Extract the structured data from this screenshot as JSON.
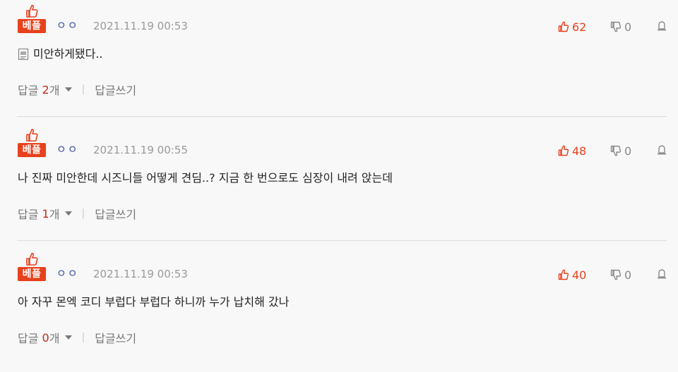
{
  "comments": [
    {
      "badge": "베플",
      "nickname": "ㅇㅇ",
      "timestamp": "2021.11.19 00:53",
      "likes": "62",
      "dislikes": "0",
      "body": "미안하게됐다..",
      "has_attachment_icon": true,
      "reply_label": "답글",
      "reply_count": "2",
      "reply_unit": "개",
      "write_reply": "답글쓰기"
    },
    {
      "badge": "베플",
      "nickname": "ㅇㅇ",
      "timestamp": "2021.11.19 00:55",
      "likes": "48",
      "dislikes": "0",
      "body": "나 진짜 미안한데 시즈니들 어떻게 견딤..? 지금 한 번으로도 심장이 내려 앉는데",
      "has_attachment_icon": false,
      "reply_label": "답글",
      "reply_count": "1",
      "reply_unit": "개",
      "write_reply": "답글쓰기"
    },
    {
      "badge": "베플",
      "nickname": "ㅇㅇ",
      "timestamp": "2021.11.19 00:53",
      "likes": "40",
      "dislikes": "0",
      "body": "아 자꾸 몬엑 코디 부럽다 부럽다 하니까 누가 납치해 갔나",
      "has_attachment_icon": false,
      "reply_label": "답글",
      "reply_count": "0",
      "reply_unit": "개",
      "write_reply": "답글쓰기"
    }
  ],
  "colors": {
    "accent": "#e8411d",
    "reply_count": "#c62b1a",
    "nickname": "#3a4aa0",
    "muted": "#999999",
    "background": "#f8f8f8"
  },
  "icons": {
    "best": "thumbs-up-icon",
    "like": "thumbs-up-icon",
    "dislike": "thumbs-down-icon",
    "report": "report-icon",
    "attachment": "document-icon",
    "expand": "caret-down-icon"
  }
}
